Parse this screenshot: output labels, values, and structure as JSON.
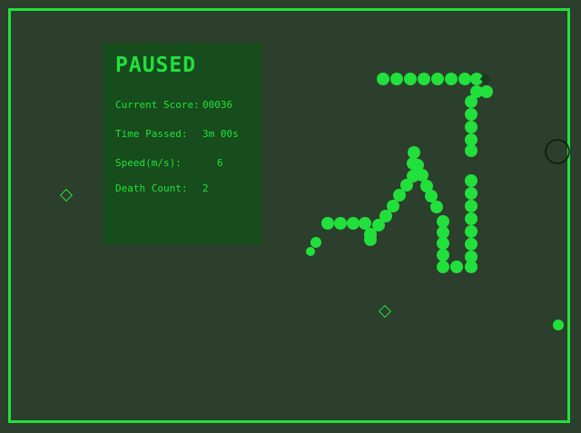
{
  "colors": {
    "background": "#2c3e2c",
    "accent": "#22e03c",
    "panel": "#174c1c"
  },
  "pause_panel": {
    "title": "PAUSED",
    "stats": [
      {
        "label": "Current Score:",
        "value": "00036"
      },
      {
        "label": "Time Passed:",
        "value": "3m 00s"
      },
      {
        "label": "Speed(m/s):",
        "value": "6"
      },
      {
        "label": "Death Count:",
        "value": "2"
      }
    ]
  },
  "icons": [
    "diamond-food-icon",
    "ring-portal-icon",
    "dot-food-icon",
    "snake-head-diamond-icon"
  ]
}
